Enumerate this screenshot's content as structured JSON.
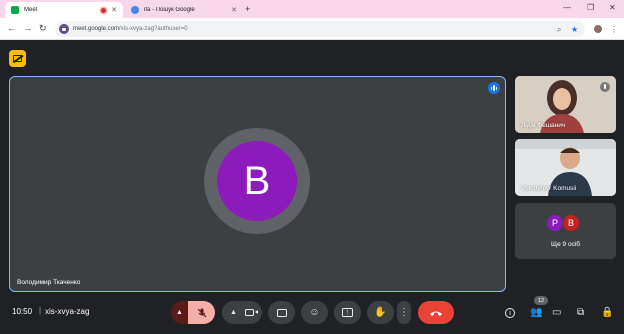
{
  "tabs": [
    {
      "title": "Meet",
      "active": true,
      "recording": true,
      "favicon_color": "#00ac47"
    },
    {
      "title": "ifa - Пошук Google",
      "active": false,
      "favicon_color": "#4285f4"
    }
  ],
  "window_controls": {
    "minimize": "—",
    "restore": "❐",
    "close": "✕"
  },
  "omnibox": {
    "host": "meet.google.com",
    "path": "/xis-xvya-zag?authuser=0"
  },
  "main_tile": {
    "initial": "B",
    "name": "Володимир Ткаченко",
    "avatar_color": "#8d1bbb"
  },
  "side_tiles": [
    {
      "name": "Лідія Фешанич"
    },
    {
      "name": "Volodymyr Komusii"
    },
    {
      "more_label": "Ще 9 осіб",
      "avatars": [
        {
          "initial": "P",
          "color": "#8d1bbb"
        },
        {
          "initial": "B",
          "color": "#c5221f"
        }
      ]
    }
  ],
  "bottom_bar": {
    "time": "10:50",
    "separator": "|",
    "meeting_code": "xis-xvya-zag",
    "participant_count": "12"
  },
  "colors": {
    "accent": "#8ab4f8",
    "end_call": "#ea4335",
    "tab_strip": "#f9d7ea"
  }
}
